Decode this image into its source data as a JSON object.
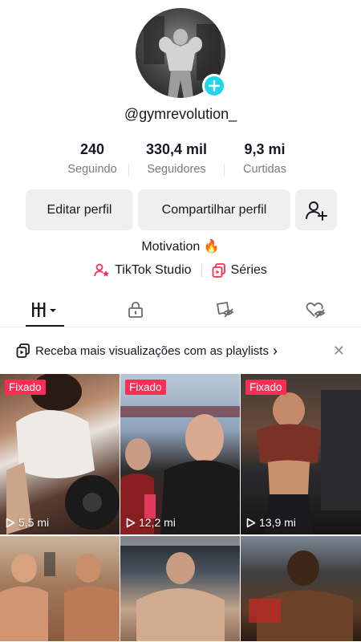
{
  "profile": {
    "username": "@gymrevolution_",
    "bio": "Motivation 🔥"
  },
  "stats": [
    {
      "value": "240",
      "label": "Seguindo"
    },
    {
      "value": "330,4 mil",
      "label": "Seguidores"
    },
    {
      "value": "9,3 mi",
      "label": "Curtidas"
    }
  ],
  "actions": {
    "edit_label": "Editar perfil",
    "share_label": "Compartilhar perfil"
  },
  "links": {
    "studio_label": "TikTok Studio",
    "series_label": "Séries"
  },
  "tabs": [
    "videos-grid-icon",
    "lock-icon",
    "repost-icon",
    "liked-icon"
  ],
  "promo": {
    "text": "Receba mais visualizações com as playlists",
    "chevron": "›",
    "close": "✕"
  },
  "videos": [
    {
      "pinned_label": "Fixado",
      "views": "5,5 mi"
    },
    {
      "pinned_label": "Fixado",
      "views": "12,2 mi"
    },
    {
      "pinned_label": "Fixado",
      "views": "13,9 mi"
    },
    {
      "pinned_label": "",
      "views": ""
    },
    {
      "pinned_label": "",
      "views": ""
    },
    {
      "pinned_label": "",
      "views": ""
    }
  ],
  "colors": {
    "accent": "#fe2c55",
    "avatar_add": "#20d5ec",
    "button_bg": "#efeff0",
    "text_secondary": "#7a7b80"
  }
}
